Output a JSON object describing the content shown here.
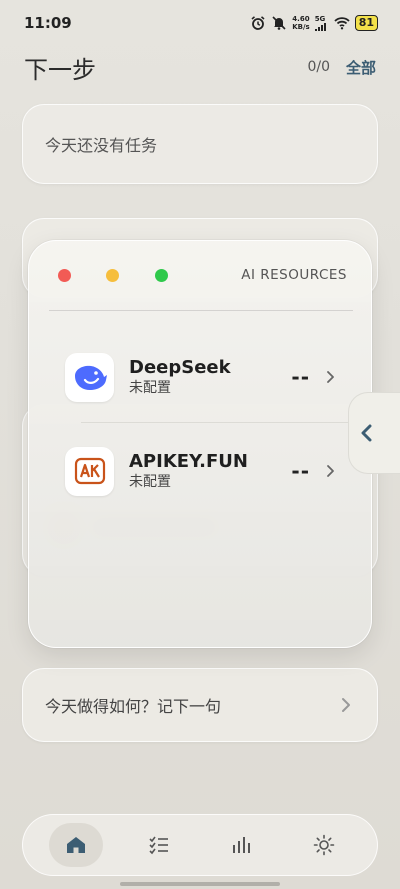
{
  "status": {
    "time": "11:09",
    "net_speed_value": "4.60",
    "net_speed_unit": "KB/s",
    "network": "5G",
    "battery": "81"
  },
  "header": {
    "title": "下一步",
    "counter": "0/0",
    "filter_label": "全部"
  },
  "tasks": {
    "empty_text": "今天还没有任务"
  },
  "journal": {
    "prompt": "今天做得如何？记下一句"
  },
  "ai_resources": {
    "title": "AI RESOURCES",
    "items": [
      {
        "name": "DeepSeek",
        "status": "未配置",
        "value": "--",
        "icon": "deepseek-whale-icon"
      },
      {
        "name": "APIKEY.FUN",
        "status": "未配置",
        "value": "--",
        "icon": "apikey-ak-icon"
      }
    ]
  },
  "tabs": [
    {
      "icon": "home-icon",
      "active": true
    },
    {
      "icon": "checklist-icon",
      "active": false
    },
    {
      "icon": "bar-chart-icon",
      "active": false
    },
    {
      "icon": "sun-icon",
      "active": false
    }
  ],
  "colors": {
    "accent": "#3c5d73",
    "traffic_red": "#f25b55",
    "traffic_yellow": "#f6be3c",
    "traffic_green": "#2fc94b",
    "deepseek_blue": "#4d6bfe",
    "apikey_orange": "#c9531a",
    "battery_yellow": "#f3e14a"
  }
}
